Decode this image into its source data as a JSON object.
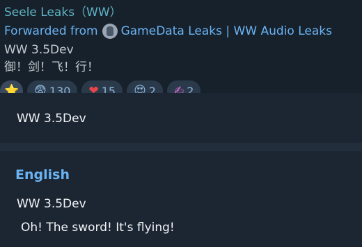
{
  "message": {
    "sender": "Seele Leaks（WW）",
    "forwarded_from_label": "Forwarded from",
    "forwarded_source": "GameData Leaks | WW Audio Leaks",
    "text_line1": "WW 3.5Dev",
    "text_line2": "御！剑！飞！行！"
  },
  "reactions": [
    {
      "emoji": "⭐",
      "icon": "star-icon",
      "count": ""
    },
    {
      "emoji": "😨",
      "icon": "fearful-face-icon",
      "count": "130"
    },
    {
      "emoji": "❤",
      "icon": "heart-icon",
      "count": "15"
    },
    {
      "emoji": "😍",
      "icon": "heart-eyes-icon",
      "count": "2"
    },
    {
      "emoji": "✍",
      "icon": "writing-hand-icon",
      "count": "2"
    }
  ],
  "translation": {
    "original_text": "WW 3.5Dev",
    "language_label": "English",
    "translated_line1": "WW 3.5Dev",
    "translated_line2": "Oh! The sword! It's flying!"
  },
  "colors": {
    "accent": "#6ab3f3",
    "sender": "#5fb3c4",
    "panel_bg": "#1c2633",
    "text": "#f2f4f6"
  }
}
